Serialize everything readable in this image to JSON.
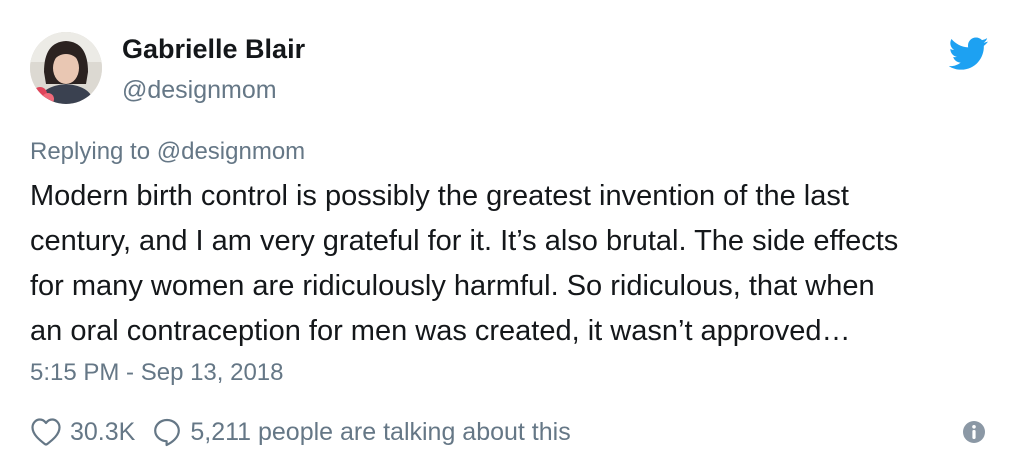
{
  "author": {
    "name": "Gabrielle Blair",
    "handle": "@designmom"
  },
  "reply": {
    "text": "Replying to @designmom"
  },
  "tweet": {
    "lines": [
      "Modern birth control is possibly the greatest invention of the last",
      "century, and I am very grateful for it. It’s also brutal. The side effects",
      "for many women are ridiculously harmful. So ridiculous, that when",
      "an oral contraception for men was created, it wasn’t approved…"
    ],
    "timestamp": "5:15 PM - Sep 13, 2018"
  },
  "stats": {
    "likes": "30.3K",
    "talking": "5,211 people are talking about this"
  },
  "icons": {
    "brand": "twitter-bird-icon",
    "like": "heart-icon",
    "reply": "speech-bubble-icon",
    "info": "info-icon"
  },
  "colors": {
    "brand": "#1da1f2",
    "text": "#14171a",
    "secondary": "#657786",
    "info_icon": "#8b98a5"
  }
}
